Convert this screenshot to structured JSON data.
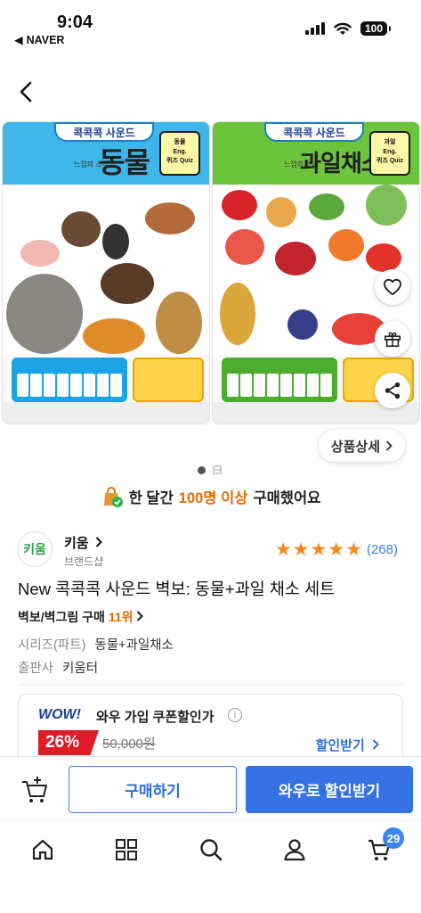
{
  "status_bar": {
    "time": "9:04",
    "carrier": "NAVER",
    "battery": "100"
  },
  "gallery": {
    "posters": [
      {
        "brand": "콕콕콕 사운드",
        "title": "동물",
        "subtitle": "느낌의 소리",
        "panel": [
          "동물",
          "Eng.",
          "퀴즈 Quiz"
        ]
      },
      {
        "brand": "콕콕콕 사운드",
        "title": "과일채소",
        "subtitle": "느낌의 소리",
        "panel": [
          "과일",
          "Eng.",
          "퀴즈 Quiz"
        ]
      }
    ],
    "detail_button": "상품상세",
    "page_indicator": "1 / 2"
  },
  "buyers_notice": {
    "prefix": "한 달간",
    "highlight": "100명 이상",
    "suffix": "구매했어요"
  },
  "seller": {
    "logo_text": "키움",
    "name": "키움",
    "subtitle": "브랜드샵",
    "rating_count": "(268)",
    "stars": 5
  },
  "product": {
    "title": "New 콕콕콕 사운드 벽보: 동물+과일 채소 세트",
    "ranking_category": "벽보/벽그림 구매",
    "ranking_value": "11위",
    "meta": [
      {
        "key": "시리즈(파트)",
        "value": "동물+과일채소"
      },
      {
        "key": "출판사",
        "value": "키움터"
      }
    ]
  },
  "coupon": {
    "wow": "WOW!",
    "label": "와우 가입 쿠폰할인가",
    "percent": "26%",
    "original_price": "50,000원",
    "discount_link": "할인받기"
  },
  "actions": {
    "buy": "구매하기",
    "wow_buy": "와우로 할인받기"
  },
  "tabbar": {
    "items": [
      "home-icon",
      "category-grid-icon",
      "search-icon",
      "profile-icon",
      "cart-icon"
    ],
    "cart_badge": "29"
  },
  "colors": {
    "accent_blue": "#3472e6",
    "highlight_orange": "#e36a00",
    "sale_red": "#e01b28",
    "star_orange": "#f48a1f"
  }
}
